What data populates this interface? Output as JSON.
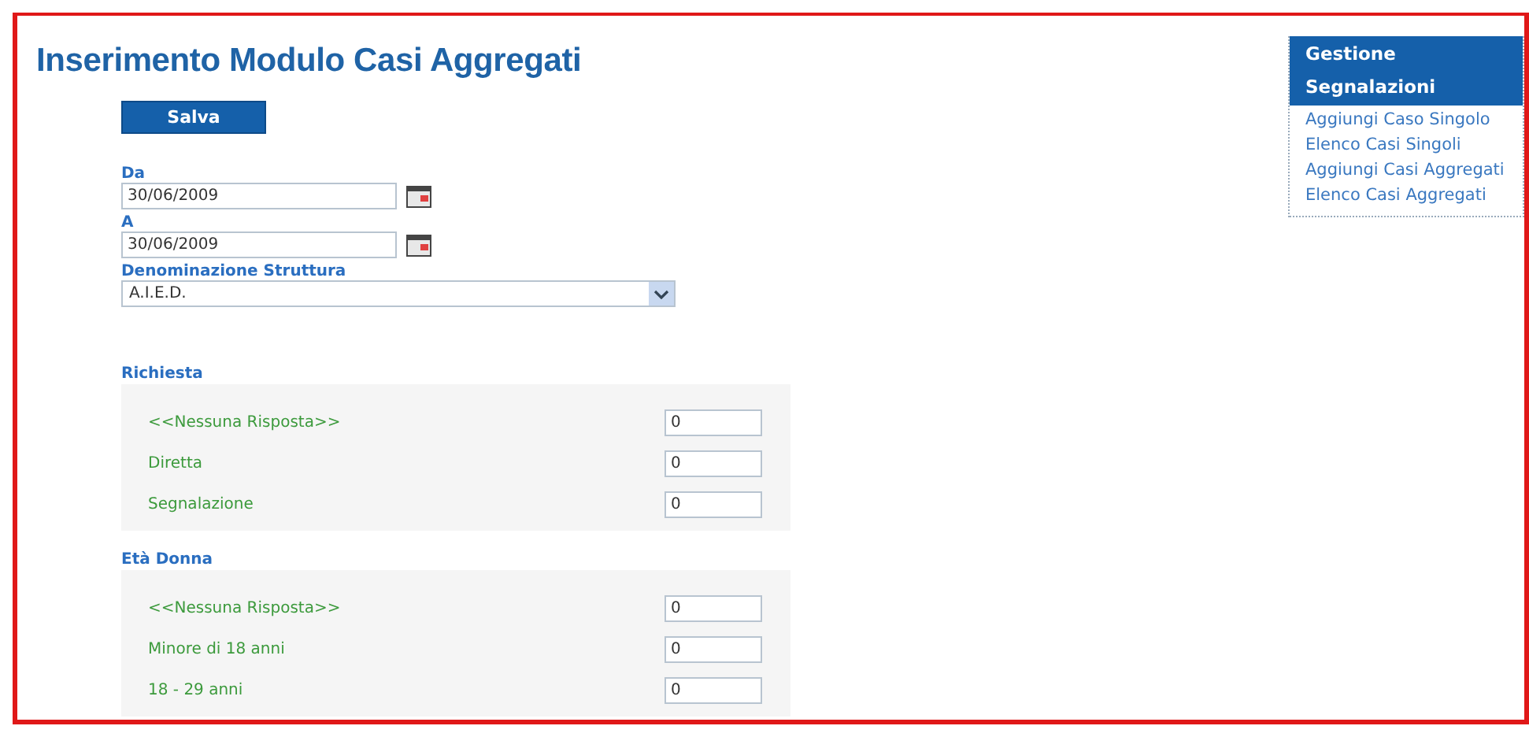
{
  "page": {
    "title": "Inserimento Modulo Casi Aggregati"
  },
  "save_button": {
    "label": "Salva"
  },
  "date_fields": [
    {
      "label": "Da",
      "value": "30/06/2009"
    },
    {
      "label": "A",
      "value": "30/06/2009"
    }
  ],
  "structure_field": {
    "label": "Denominazione Struttura",
    "value": "A.I.E.D."
  },
  "sections": [
    {
      "title": "Richiesta",
      "rows": [
        {
          "label": "<<Nessuna Risposta>>",
          "value": "0"
        },
        {
          "label": "Diretta",
          "value": "0"
        },
        {
          "label": "Segnalazione",
          "value": "0"
        }
      ]
    },
    {
      "title": "Età Donna",
      "rows": [
        {
          "label": "<<Nessuna Risposta>>",
          "value": "0"
        },
        {
          "label": "Minore di 18 anni",
          "value": "0"
        },
        {
          "label": "18 - 29 anni",
          "value": "0"
        }
      ]
    }
  ],
  "sidebar": {
    "title": "Gestione Segnalazioni",
    "items": [
      {
        "label": "Aggiungi Caso Singolo"
      },
      {
        "label": "Elenco Casi Singoli"
      },
      {
        "label": "Aggiungi Casi Aggregati"
      },
      {
        "label": "Elenco Casi Aggregati"
      }
    ]
  }
}
